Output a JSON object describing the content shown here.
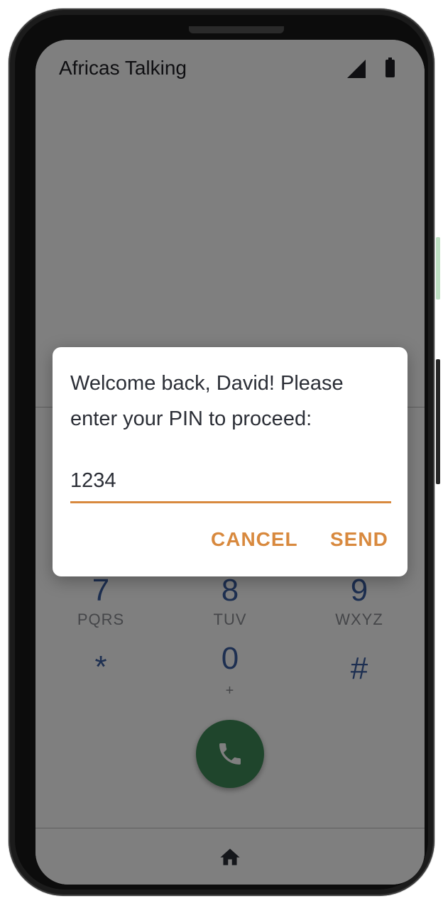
{
  "status_bar": {
    "carrier": "Africas Talking",
    "icons": [
      "signal-icon",
      "battery-icon"
    ]
  },
  "keypad": {
    "rows": [
      [
        {
          "digit": "7",
          "letters": "PQRS"
        },
        {
          "digit": "8",
          "letters": "TUV"
        },
        {
          "digit": "9",
          "letters": "WXYZ"
        }
      ],
      [
        {
          "digit": "*",
          "letters": ""
        },
        {
          "digit": "0",
          "letters": "+"
        },
        {
          "digit": "#",
          "letters": ""
        }
      ]
    ],
    "call_icon": "phone-icon",
    "call_color": "#3f8a59",
    "digit_color": "#3b5fa3"
  },
  "bottom_nav": {
    "icon": "home-icon"
  },
  "dialog": {
    "message": "Welcome back, David! Please enter your PIN to proceed:",
    "input_value": "1234",
    "cancel_label": "CANCEL",
    "send_label": "SEND",
    "accent_color": "#d8893e"
  }
}
